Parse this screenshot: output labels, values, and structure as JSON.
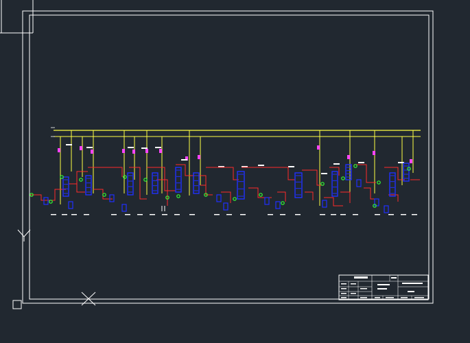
{
  "canvas": {
    "background": "#212830",
    "colors": {
      "frame": "#ffffff",
      "bus": "#ffff44",
      "pipe": "#ff2a2a",
      "vessel": "#2030ff",
      "valve": "#33ff33",
      "magenta": "#ff44ff"
    }
  },
  "icons": {
    "ucs": "ucs-icon",
    "crosshair": "crosshair-icon"
  },
  "title_block": {
    "cells": [
      "",
      "",
      "",
      "",
      "",
      ""
    ]
  }
}
